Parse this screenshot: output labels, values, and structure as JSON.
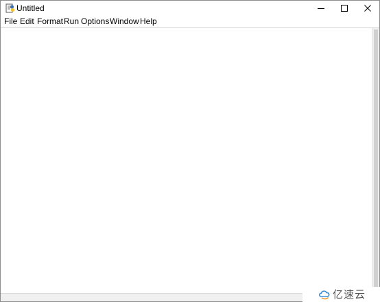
{
  "window": {
    "title": "Untitled",
    "icon": "python-idle-icon"
  },
  "caption_buttons": {
    "minimize": "minimize-icon",
    "maximize": "maximize-icon",
    "close": "close-icon"
  },
  "menu": {
    "items": [
      {
        "label": "File"
      },
      {
        "label": "Edit"
      },
      {
        "label": "Format"
      },
      {
        "label": "Run"
      },
      {
        "label": "Options"
      },
      {
        "label": "Window"
      },
      {
        "label": "Help"
      }
    ]
  },
  "editor": {
    "content": ""
  },
  "watermark": {
    "text": "亿速云",
    "icon": "cloud-logo-icon"
  },
  "colors": {
    "window_bg": "#ffffff",
    "border": "#8c8c8c",
    "scrollbar_track": "#f0f0f0",
    "watermark_text": "#555555"
  }
}
